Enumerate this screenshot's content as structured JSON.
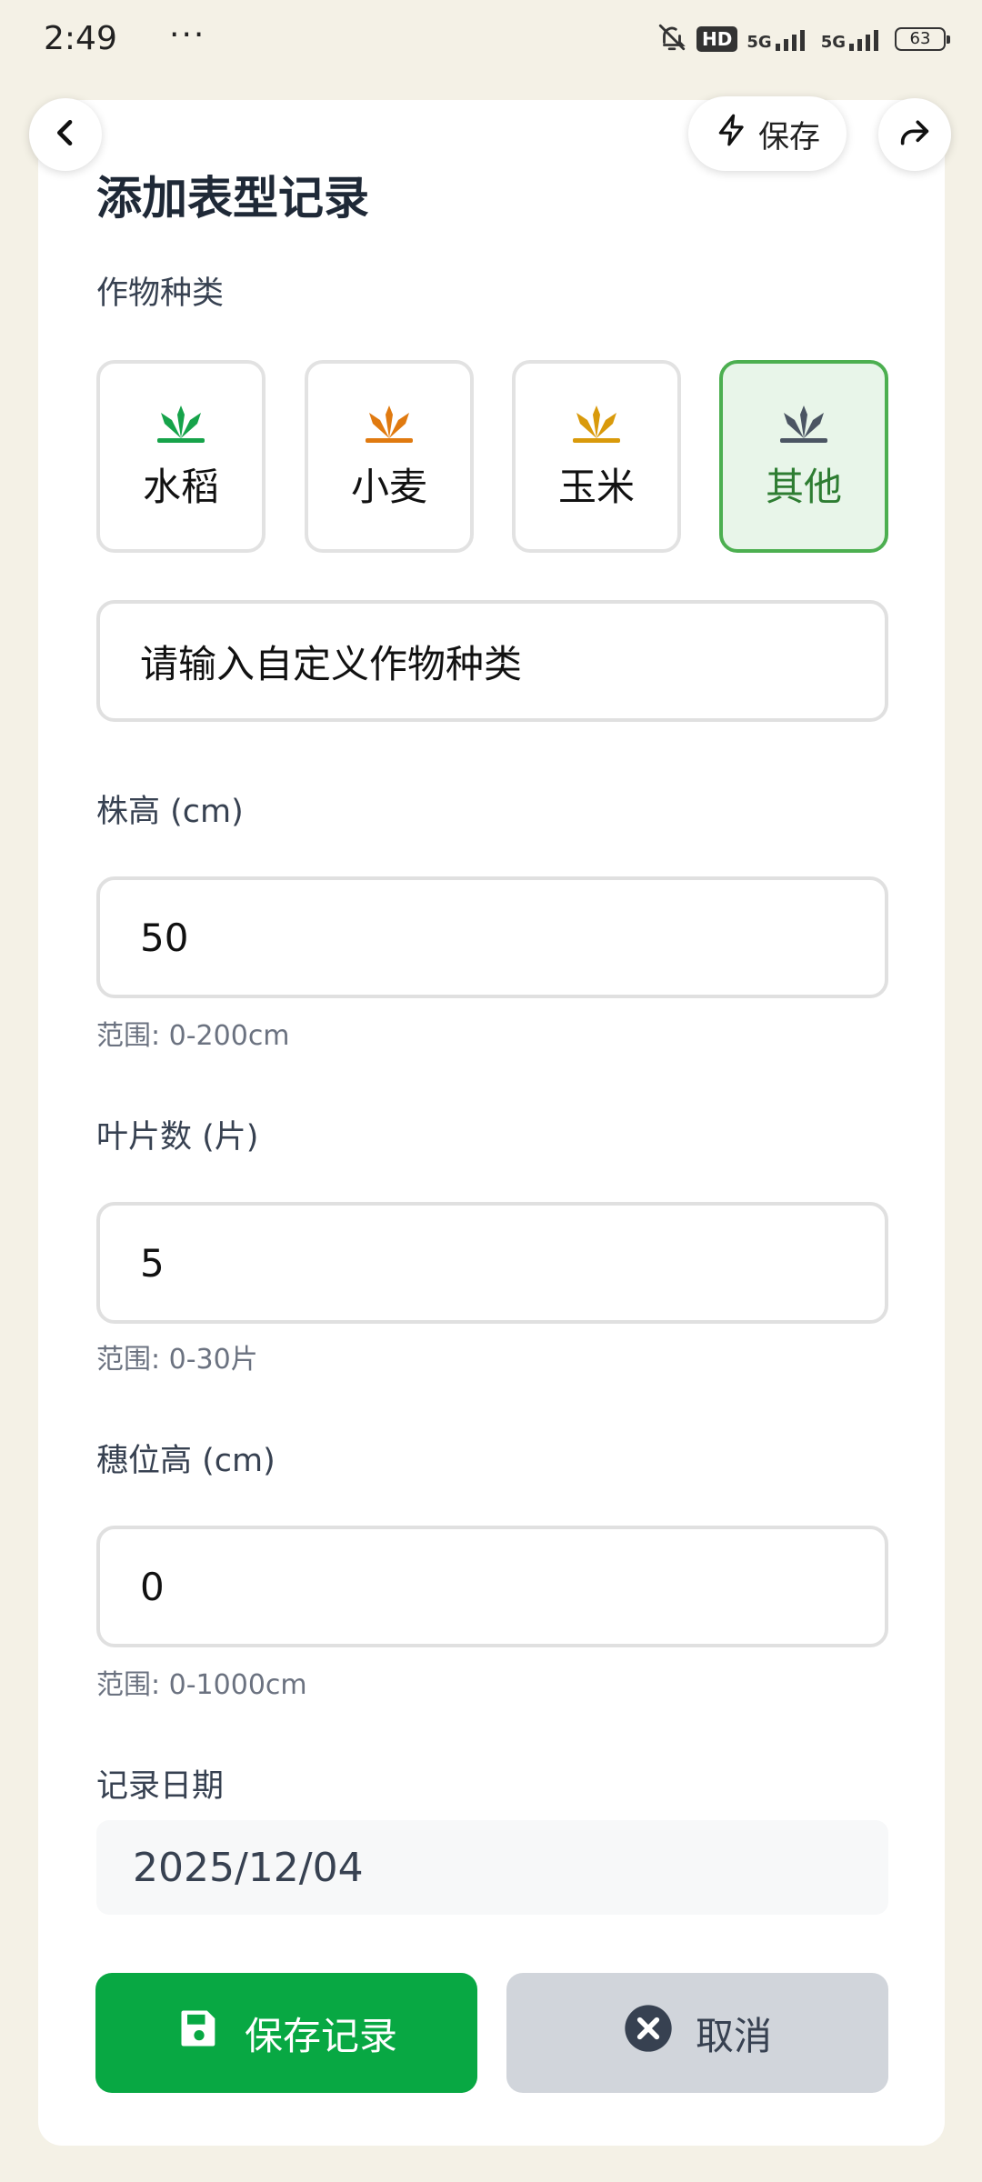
{
  "status_bar": {
    "time": "2:49",
    "dots": "···",
    "hd_badge": "HD",
    "net1": "5G",
    "net2": "5G",
    "battery": "63"
  },
  "toolbar": {
    "back_icon": "chevron-left-icon",
    "save_label": "保存",
    "save_icon": "lightning-icon",
    "share_icon": "share-arrow-icon"
  },
  "form": {
    "title": "添加表型记录",
    "crop_type_label": "作物种类",
    "crop_options": [
      {
        "label": "水稻",
        "color": "#16a34a",
        "selected": false
      },
      {
        "label": "小麦",
        "color": "#e07a10",
        "selected": false
      },
      {
        "label": "玉米",
        "color": "#d99a0b",
        "selected": false
      },
      {
        "label": "其他",
        "color": "#4b5563",
        "selected": true
      }
    ],
    "custom_crop_placeholder": "请输入自定义作物种类",
    "plant_height": {
      "label": "株高 (cm)",
      "value": "50",
      "hint": "范围: 0-200cm"
    },
    "leaf_count": {
      "label": "叶片数 (片)",
      "value": "5",
      "hint": "范围: 0-30片"
    },
    "ear_height": {
      "label": "穗位高 (cm)",
      "value": "0",
      "hint": "范围: 0-1000cm"
    },
    "record_date": {
      "label": "记录日期",
      "value": "2025/12/04"
    }
  },
  "actions": {
    "save_record": "保存记录",
    "cancel": "取消"
  },
  "colors": {
    "primary_green": "#08a843",
    "selected_border": "#4caf50",
    "cancel_bg": "#d1d5db",
    "background": "#f4f1e6"
  }
}
